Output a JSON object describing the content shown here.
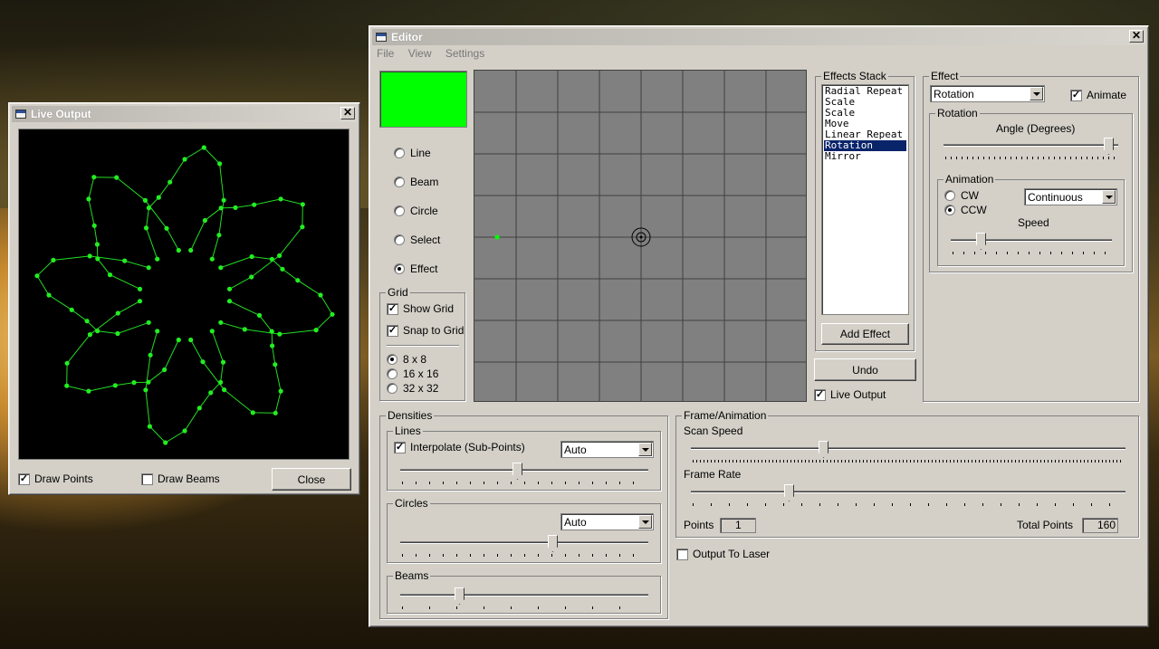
{
  "live_output": {
    "title": "Live Output",
    "draw_points_label": "Draw Points",
    "draw_points_checked": true,
    "draw_beams_label": "Draw Beams",
    "draw_beams_checked": false,
    "close_label": "Close"
  },
  "editor": {
    "title": "Editor",
    "menu": [
      "File",
      "View",
      "Settings"
    ],
    "color_swatch": "#00ff00",
    "tools": [
      {
        "label": "Line",
        "selected": false
      },
      {
        "label": "Beam",
        "selected": false
      },
      {
        "label": "Circle",
        "selected": false
      },
      {
        "label": "Select",
        "selected": false
      },
      {
        "label": "Effect",
        "selected": true
      }
    ],
    "grid": {
      "title": "Grid",
      "show_grid_label": "Show Grid",
      "show_grid_checked": true,
      "snap_label": "Snap to Grid",
      "snap_checked": true,
      "sizes": [
        {
          "label": "8 x 8",
          "selected": true
        },
        {
          "label": "16 x 16",
          "selected": false
        },
        {
          "label": "32 x 32",
          "selected": false
        }
      ]
    },
    "effects_stack": {
      "title": "Effects Stack",
      "items": [
        "Radial Repeat",
        "Scale",
        "Scale",
        "Move",
        "Linear Repeat",
        "Rotation",
        "Mirror"
      ],
      "selected_index": 5,
      "add_label": "Add Effect"
    },
    "undo_label": "Undo",
    "live_output_label": "Live Output",
    "live_output_checked": true,
    "effect": {
      "title": "Effect",
      "combo_value": "Rotation",
      "animate_label": "Animate",
      "animate_checked": true,
      "rotation_title": "Rotation",
      "angle_label": "Angle (Degrees)",
      "angle_value": 0.97,
      "animation_title": "Animation",
      "cw_label": "CW",
      "ccw_label": "CCW",
      "direction": "CCW",
      "mode_value": "Continuous",
      "speed_label": "Speed",
      "speed_value": 0.17
    },
    "densities": {
      "title": "Densities",
      "lines_title": "Lines",
      "interpolate_label": "Interpolate (Sub-Points)",
      "interpolate_checked": true,
      "lines_combo": "Auto",
      "lines_value": 0.47,
      "circles_title": "Circles",
      "circles_combo": "Auto",
      "circles_value": 0.62,
      "beams_title": "Beams",
      "beams_value": 0.23
    },
    "frame": {
      "title": "Frame/Animation",
      "scan_speed_label": "Scan Speed",
      "scan_speed_value": 0.3,
      "frame_rate_label": "Frame Rate",
      "frame_rate_value": 0.22,
      "points_label": "Points",
      "points_value": "1",
      "total_points_label": "Total Points",
      "total_points_value": "160"
    },
    "output_laser_label": "Output To Laser",
    "output_laser_checked": false
  }
}
